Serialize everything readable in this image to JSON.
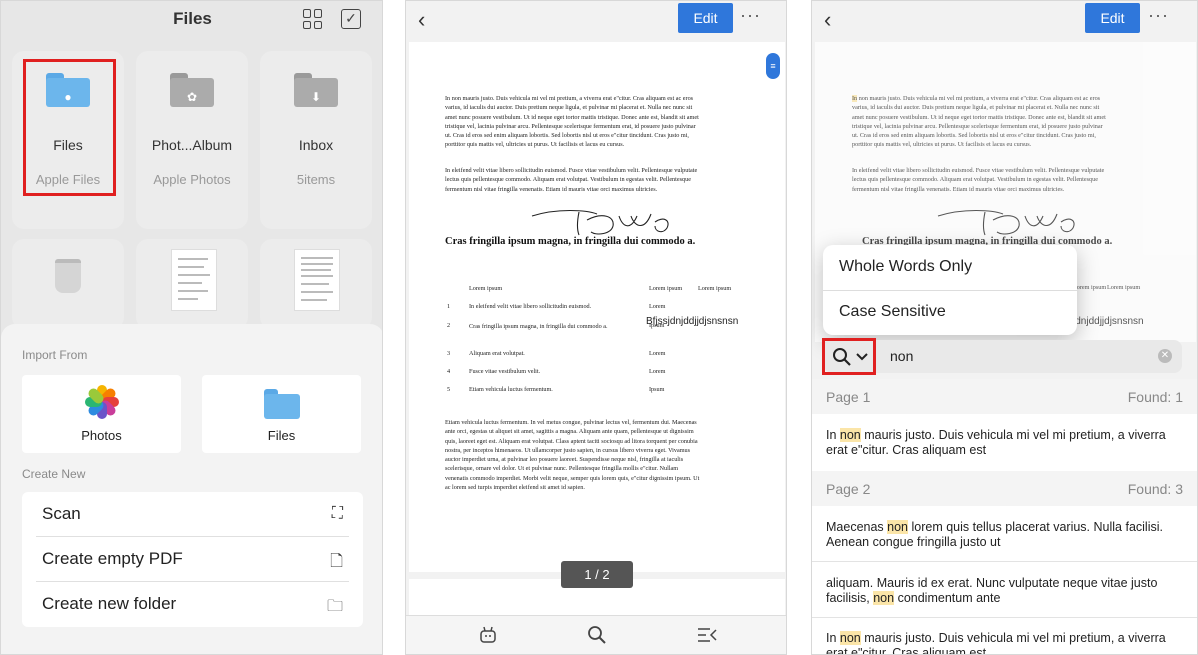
{
  "panel1": {
    "title": "Files",
    "icons": [
      "grid-view-icon",
      "select-checkbox-icon"
    ],
    "tiles": [
      {
        "name": "Files",
        "sub": "Apple Files"
      },
      {
        "name": "Phot...Album",
        "sub": "Apple Photos"
      },
      {
        "name": "Inbox",
        "sub": "5items"
      }
    ],
    "sheet": {
      "import_label": "Import From",
      "import_items": [
        "Photos",
        "Files"
      ],
      "create_label": "Create New",
      "create_items": [
        "Scan",
        "Create empty PDF",
        "Create new folder"
      ]
    }
  },
  "viewer": {
    "edit": "Edit",
    "paragraph1": "In non mauris justo. Duis vehicula mi vel mi pretium, a viverra erat e\"citur. Cras aliquam est ac eros varius, id iaculis dui auctor. Duis pretium neque ligula, et pulvinar mi placerat et. Nulla nec nunc sit amet nunc posuere vestibulum. Ut id neque eget tortor mattis tristique. Donec ante est, blandit sit amet tristique vel, lacinia pulvinar arcu. Pellentesque scelerisque fermentum erat, id posuere justo pulvinar ut. Cras id eros sed enim aliquam lobortis. Sed lobortis nisl ut eros e\"citur tincidunt. Cras justo mi, porttitor quis mattis vel, ultricies ut purus. Ut facilisis et lacus eu cursus.",
    "paragraph2": "In eleifend velit vitae libero sollicitudin euismod. Fusce vitae vestibulum velit. Pellentesque vulputate lectus quis pellentesque commodo. Aliquam erat volutpat. Vestibulum in egestas velit. Pellentesque fermentum nisl vitae fringilla venenatis. Etiam id mauris vitae orci maximus ultricies.",
    "heading": "Cras fringilla ipsum magna, in fringilla dui commodo a.",
    "table": {
      "header": [
        "Lorem ipsum",
        "Lorem ipsum",
        "Lorem ipsum"
      ],
      "rows": [
        [
          "1",
          "In eleifend velit vitae libero sollicitudin euismod.",
          "Lorem"
        ],
        [
          "2",
          "Cras fringilla ipsum magna, in fringilla dui commodo a.",
          "Ipsum"
        ],
        [
          "3",
          "Aliquam erat volutpat.",
          "Lorem"
        ],
        [
          "4",
          "Fusce vitae vestibulum velit.",
          "Lorem"
        ],
        [
          "5",
          "Etiam vehicula luctus fermentum.",
          "Ipsum"
        ]
      ],
      "handwritten": "Bfjssjdnjddjjdjsnsnsn"
    },
    "paragraph3": "Etiam vehicula luctus fermentum. In vel metus congue, pulvinar lectus vel, fermentum dui. Maecenas ante orci, egestas ut aliquet sit amet, sagittis a magna. Aliquam ante quam, pellentesque ut dignissim quis, laoreet eget est. Aliquam erat volutpat. Class aptent taciti sociosqu ad litora torquent per conubia nostra, per inceptos himenaeos. Ut ullamcorper justo sapien, in cursus libero viverra eget. Vivamus auctor imperdiet urna, at pulvinar leo posuere laoreet. Suspendisse neque nisl, fringilla at iaculis scelerisque, ornare vel dolor. Ut et pulvinar nunc. Pellentesque fringilla mollis e\"citur. Nullam venenatis commodo imperdiet. Morbi velit neque, semper quis lorem quis, e\"citur dignissim ipsum. Ut ac lorem sed turpis imperdiet eleifend sit amet id sapien.",
    "page_counter": "1 / 2",
    "toolbar_icons": [
      "bot-icon",
      "search-icon",
      "outline-list-icon"
    ]
  },
  "search": {
    "options": [
      "Whole Words Only",
      "Case Sensitive"
    ],
    "query": "non",
    "results": [
      {
        "page": "Page 1",
        "found": "Found: 1",
        "items": [
          {
            "before": "In ",
            "match": "non",
            "after": " mauris justo. Duis vehicula mi vel mi pretium, a viverra erat e\"citur. Cras aliquam est"
          }
        ]
      },
      {
        "page": "Page 2",
        "found": "Found: 3",
        "items": [
          {
            "before": "Maecenas ",
            "match": "non",
            "after": " lorem quis tellus placerat varius. Nulla facilisi. Aenean congue fringilla justo ut"
          },
          {
            "before": "aliquam. Mauris id ex erat. Nunc vulputate neque vitae justo facilisis, ",
            "match": "non",
            "after": " condimentum ante"
          },
          {
            "before": "In ",
            "match": "non",
            "after": " mauris justo. Duis vehicula mi vel mi pretium, a viverra erat e\"citur. Cras aliquam est"
          }
        ]
      }
    ],
    "bg_table_header": [
      "Lorem ipsum",
      "Lorem ipsum"
    ],
    "bg_handwritten": "jdnjddjjdjsnsnsn"
  },
  "colors": {
    "accent": "#2f77db",
    "highlight_box": "#e02020",
    "match_bg": "#fbe5a8"
  }
}
